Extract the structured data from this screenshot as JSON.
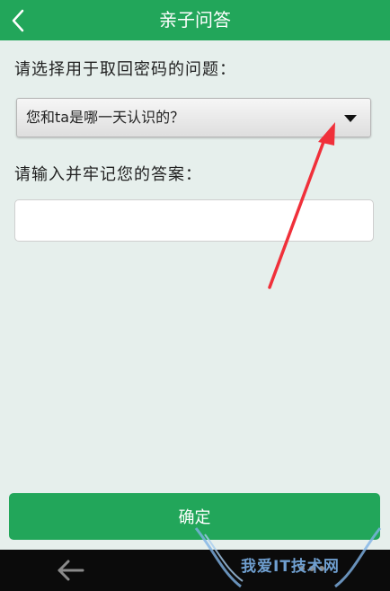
{
  "header": {
    "title": "亲子问答",
    "background_color": "#22a65a"
  },
  "form": {
    "question_label": "请选择用于取回密码的问题：",
    "selected_question": "您和ta是哪一天认识的？",
    "answer_label": "请输入并牢记您的答案：",
    "answer_value": ""
  },
  "actions": {
    "confirm_label": "确定"
  },
  "annotation": {
    "arrow_color": "#f0303a"
  },
  "watermark": {
    "text": "我爱IT技术网"
  }
}
